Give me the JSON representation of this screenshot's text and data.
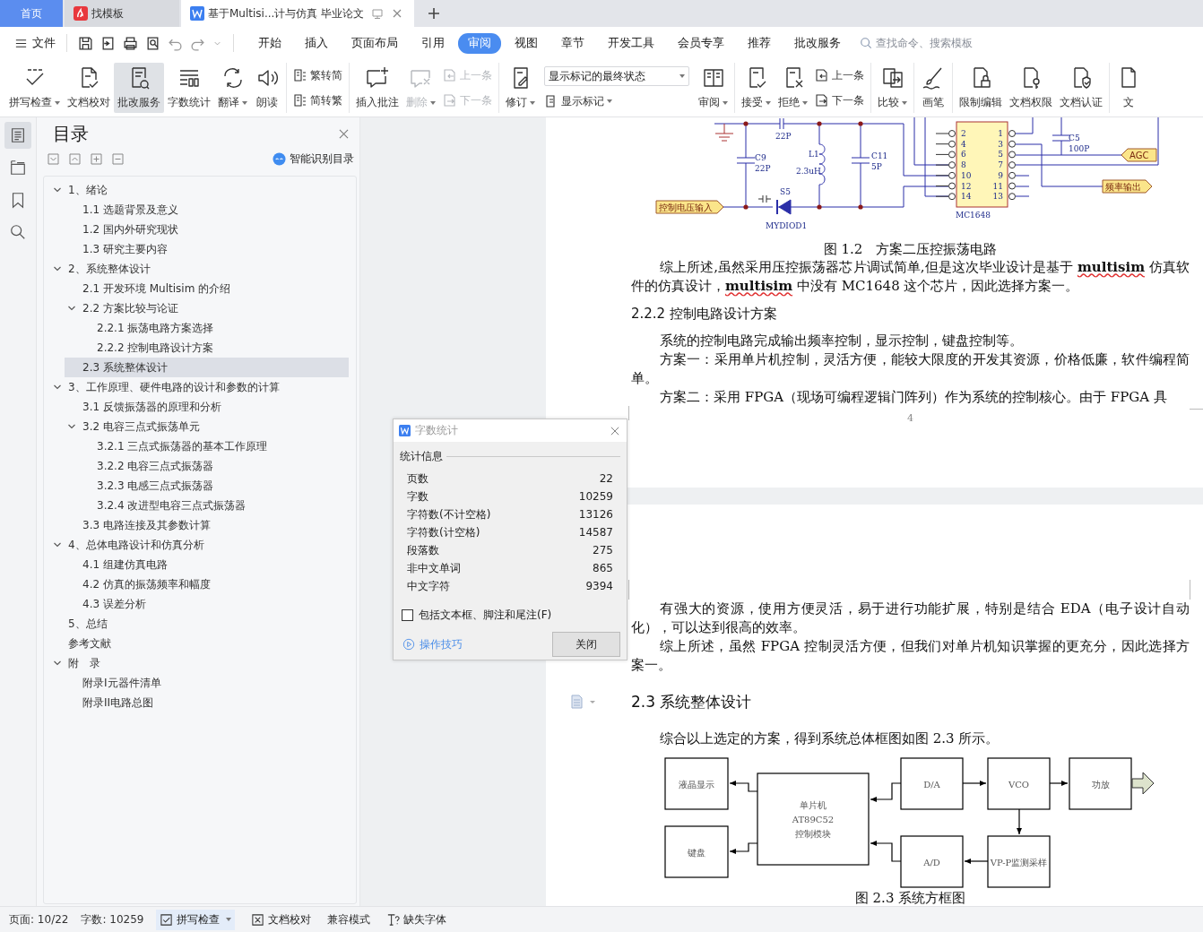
{
  "tabs": [
    {
      "kind": "home",
      "label": "首页",
      "selected": false
    },
    {
      "kind": "template",
      "label": "找模板",
      "selected": false
    },
    {
      "kind": "document",
      "label": "基于Multisi...计与仿真 毕业论文",
      "selected": true
    }
  ],
  "menu": {
    "file_label": "文件",
    "items": [
      {
        "label": "开始",
        "selected": false
      },
      {
        "label": "插入",
        "selected": false
      },
      {
        "label": "页面布局",
        "selected": false
      },
      {
        "label": "引用",
        "selected": false
      },
      {
        "label": "审阅",
        "selected": true
      },
      {
        "label": "视图",
        "selected": false
      },
      {
        "label": "章节",
        "selected": false
      },
      {
        "label": "开发工具",
        "selected": false
      },
      {
        "label": "会员专享",
        "selected": false
      },
      {
        "label": "推荐",
        "selected": false
      },
      {
        "label": "批改服务",
        "selected": false
      }
    ],
    "search": {
      "placeholder": "查找命令、搜索模板"
    }
  },
  "ribbon": [
    {
      "items": [
        {
          "kind": "big",
          "label": "拼写检查",
          "caret": true,
          "disabled": false,
          "selected": false
        },
        {
          "kind": "big",
          "label": "文档校对",
          "caret": false,
          "disabled": false,
          "selected": false
        },
        {
          "kind": "big",
          "label": "批改服务",
          "caret": false,
          "disabled": false,
          "selected": true
        },
        {
          "kind": "big",
          "label": "字数统计",
          "caret": false,
          "disabled": false,
          "selected": false
        },
        {
          "kind": "big",
          "label": "翻译",
          "caret": true,
          "disabled": false,
          "selected": false
        },
        {
          "kind": "big",
          "label": "朗读",
          "caret": false,
          "disabled": false,
          "selected": false
        }
      ]
    },
    {
      "items": [
        {
          "kind": "pair",
          "items": [
            {
              "label": "繁转简",
              "disabled": false
            },
            {
              "label": "简转繁",
              "disabled": false
            }
          ]
        }
      ]
    },
    {
      "items": [
        {
          "kind": "big",
          "label": "插入批注",
          "caret": false,
          "disabled": false,
          "selected": false
        },
        {
          "kind": "big",
          "label": "删除",
          "caret": true,
          "disabled": true,
          "selected": false
        },
        {
          "kind": "pair",
          "items": [
            {
              "label": "上一条",
              "disabled": true
            },
            {
              "label": "下一条",
              "disabled": true
            }
          ]
        }
      ]
    },
    {
      "items": [
        {
          "kind": "big",
          "label": "修订",
          "caret": true,
          "disabled": false,
          "selected": false
        },
        {
          "kind": "select",
          "value": "显示标记的最终状态",
          "sub_button": {
            "label": "显示标记",
            "caret": true
          }
        },
        {
          "kind": "big",
          "label": "审阅",
          "caret": true,
          "disabled": false,
          "selected": false
        }
      ]
    },
    {
      "items": [
        {
          "kind": "big",
          "label": "接受",
          "caret": true,
          "disabled": false,
          "selected": false
        },
        {
          "kind": "big",
          "label": "拒绝",
          "caret": true,
          "disabled": false,
          "selected": false
        },
        {
          "kind": "pair",
          "items": [
            {
              "label": "上一条",
              "disabled": false
            },
            {
              "label": "下一条",
              "disabled": false
            }
          ]
        }
      ]
    },
    {
      "items": [
        {
          "kind": "big",
          "label": "比较",
          "caret": true,
          "disabled": false,
          "selected": false
        }
      ]
    },
    {
      "items": [
        {
          "kind": "big",
          "label": "画笔",
          "caret": false,
          "disabled": false,
          "selected": false
        }
      ]
    },
    {
      "items": [
        {
          "kind": "big",
          "label": "限制编辑",
          "caret": false,
          "disabled": false,
          "selected": false
        },
        {
          "kind": "big",
          "label": "文档权限",
          "caret": false,
          "disabled": false,
          "selected": false
        },
        {
          "kind": "big",
          "label": "文档认证",
          "caret": false,
          "disabled": false,
          "selected": false
        }
      ]
    },
    {
      "items": [
        {
          "kind": "big",
          "label": "文",
          "caret": false,
          "disabled": false,
          "selected": false
        }
      ]
    }
  ],
  "rail": [
    {
      "selected": true
    },
    {
      "selected": false
    },
    {
      "selected": false
    },
    {
      "selected": false
    }
  ],
  "toc": {
    "title": "目录",
    "smart_button": "智能识别目录",
    "items": [
      {
        "label": "1、绪论",
        "selected": false,
        "expanded": true,
        "children": [
          {
            "label": "1.1 选题背景及意义",
            "selected": false
          },
          {
            "label": "1.2 国内外研究现状",
            "selected": false
          },
          {
            "label": "1.3 研究主要内容",
            "selected": false
          }
        ]
      },
      {
        "label": "2、系统整体设计",
        "selected": false,
        "expanded": true,
        "children": [
          {
            "label": "2.1 开发环境 Multisim 的介绍",
            "selected": false
          },
          {
            "label": "2.2 方案比较与论证",
            "selected": false,
            "expanded": true,
            "children": [
              {
                "label": "2.2.1 振荡电路方案选择",
                "selected": false
              },
              {
                "label": "2.2.2  控制电路设计方案",
                "selected": false
              }
            ]
          },
          {
            "label": "2.3 系统整体设计",
            "selected": true
          }
        ]
      },
      {
        "label": "3、工作原理、硬件电路的设计和参数的计算",
        "selected": false,
        "expanded": true,
        "children": [
          {
            "label": "3.1  反馈振荡器的原理和分析",
            "selected": false
          },
          {
            "label": "3.2 电容三点式振荡单元",
            "selected": false,
            "expanded": true,
            "children": [
              {
                "label": "3.2.1 三点式振荡器的基本工作原理",
                "selected": false
              },
              {
                "label": "3.2.2 电容三点式振荡器",
                "selected": false
              },
              {
                "label": "3.2.3  电感三点式振荡器",
                "selected": false
              },
              {
                "label": "3.2.4 改进型电容三点式振荡器",
                "selected": false
              }
            ]
          },
          {
            "label": "3.3  电路连接及其参数计算",
            "selected": false
          }
        ]
      },
      {
        "label": "4、总体电路设计和仿真分析",
        "selected": false,
        "expanded": true,
        "children": [
          {
            "label": "4.1 组建仿真电路",
            "selected": false
          },
          {
            "label": "4.2 仿真的振荡频率和幅度",
            "selected": false
          },
          {
            "label": "4.3 误差分析",
            "selected": false
          }
        ]
      },
      {
        "label": "5、总结",
        "selected": false
      },
      {
        "label": "参考文献",
        "selected": false
      },
      {
        "label": "附　录",
        "selected": false,
        "expanded": true,
        "children": [
          {
            "label": "附录I元器件清单",
            "selected": false
          },
          {
            "label": "附录II电路总图",
            "selected": false
          }
        ]
      }
    ]
  },
  "document": {
    "page_one": {
      "circuit": {
        "labels": [
          "22P",
          "C9",
          "22P",
          "L1",
          "2.3uH",
          "C11",
          "5P",
          "S5",
          "MYDIOD1",
          "MC1648",
          "C5",
          "100P"
        ],
        "left_pins": [
          "2",
          "4",
          "6",
          "8",
          "10",
          "12",
          "14"
        ],
        "right_pins": [
          "1",
          "3",
          "5",
          "7",
          "9",
          "11",
          "13"
        ],
        "tags": [
          "控制电压输入",
          "AGC",
          "频率输出"
        ]
      },
      "caption": "图 1.2　方案二压控振荡电路",
      "summary": [
        {
          "text": "综上所述,虽然采用压控振荡器芯片调试简单,但是这次毕业设计是基于 ",
          "misspelled": false
        },
        {
          "text": "multisim",
          "misspelled": true
        },
        {
          "text": " 仿真软件的仿真设计，",
          "misspelled": false
        },
        {
          "text": "multisim",
          "misspelled": true
        },
        {
          "text": " 中没有 MC1648 这个芯片，因此选择方案一。",
          "misspelled": false
        }
      ],
      "heading": "2.2.2  控制电路设计方案",
      "paragraphs": [
        "系统的控制电路完成输出频率控制，显示控制，键盘控制等。",
        "方案一：采用单片机控制，灵活方便，能较大限度的开发其资源，价格低廉，软件编程简单。",
        "方案二：采用 FPGA（现场可编程逻辑门阵列）作为系统的控制核心。由于 FPGA 具"
      ],
      "page_number": "4"
    },
    "page_two": {
      "paragraphs": [
        "有强大的资源，使用方便灵活，易于进行功能扩展，特别是结合 EDA（电子设计自动化），可以达到很高的效率。",
        "综上所述，虽然 FPGA 控制灵活方便，但我们对单片机知识掌握的更充分，因此选择方案一。"
      ],
      "heading": "2.3 系统整体设计",
      "intro": "综合以上选定的方案，得到系统总体框图如图 2.3 所示。",
      "diagram": {
        "boxes": [
          {
            "lines": [
              "液晶显示"
            ]
          },
          {
            "lines": [
              "键盘"
            ]
          },
          {
            "lines": [
              "单片机",
              "AT89C52",
              "控制模块"
            ]
          },
          {
            "lines": [
              "D/A"
            ]
          },
          {
            "lines": [
              "VCO"
            ]
          },
          {
            "lines": [
              "功放"
            ]
          },
          {
            "lines": [
              "A/D"
            ]
          },
          {
            "lines": [
              "VP-P监测采样"
            ]
          }
        ]
      },
      "caption": "图 2.3  系统方框图"
    }
  },
  "dialog": {
    "title": "字数统计",
    "section": "统计信息",
    "rows": [
      {
        "label": "页数",
        "value": "22"
      },
      {
        "label": "字数",
        "value": "10259"
      },
      {
        "label": "字符数(不计空格)",
        "value": "13126"
      },
      {
        "label": "字符数(计空格)",
        "value": "14587"
      },
      {
        "label": "段落数",
        "value": "275"
      },
      {
        "label": "非中文单词",
        "value": "865"
      },
      {
        "label": "中文字符",
        "value": "9394"
      }
    ],
    "checkbox": {
      "label": "包括文本框、脚注和尾注(F)",
      "checked": false
    },
    "link": "操作技巧",
    "button": "关闭"
  },
  "status_bar": [
    {
      "kind": "text",
      "label": "页面: 10/22"
    },
    {
      "kind": "text",
      "label": "字数: 10259"
    },
    {
      "kind": "toggle",
      "label": "拼写检查",
      "on": true,
      "caret": true
    },
    {
      "kind": "tool",
      "label": "文档校对"
    },
    {
      "kind": "text",
      "label": "兼容模式"
    },
    {
      "kind": "tool",
      "label": "缺失字体"
    }
  ]
}
